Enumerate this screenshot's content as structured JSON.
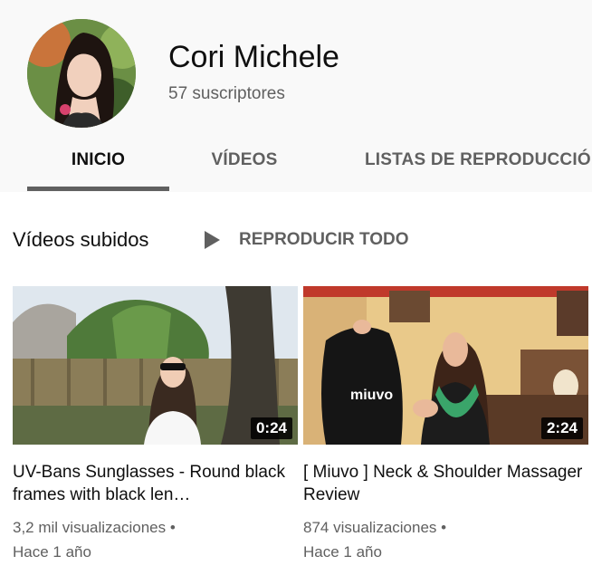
{
  "channel": {
    "name": "Cori Michele",
    "subscribers": "57 suscriptores"
  },
  "tabs": [
    {
      "label": "INICIO",
      "active": true
    },
    {
      "label": "VÍDEOS",
      "active": false
    },
    {
      "label": "LISTAS DE REPRODUCCIÓN",
      "active": false
    }
  ],
  "section": {
    "title": "Vídeos subidos",
    "play_all_label": "REPRODUCIR TODO"
  },
  "videos": [
    {
      "title": "UV-Bans Sunglasses - Round black frames with black len…",
      "duration": "0:24",
      "views": "3,2 mil visualizaciones •",
      "age": "Hace 1 año"
    },
    {
      "title": "[ Miuvo ] Neck & Shoulder Massager Review",
      "duration": "2:24",
      "views": "874 visualizaciones •",
      "age": "Hace 1 año",
      "bag_text": "miuvo"
    }
  ],
  "colors": {
    "header_bg": "#f9f9f9",
    "text_primary": "#0f0f0f",
    "text_secondary": "#606060",
    "tab_underline": "#606060"
  }
}
